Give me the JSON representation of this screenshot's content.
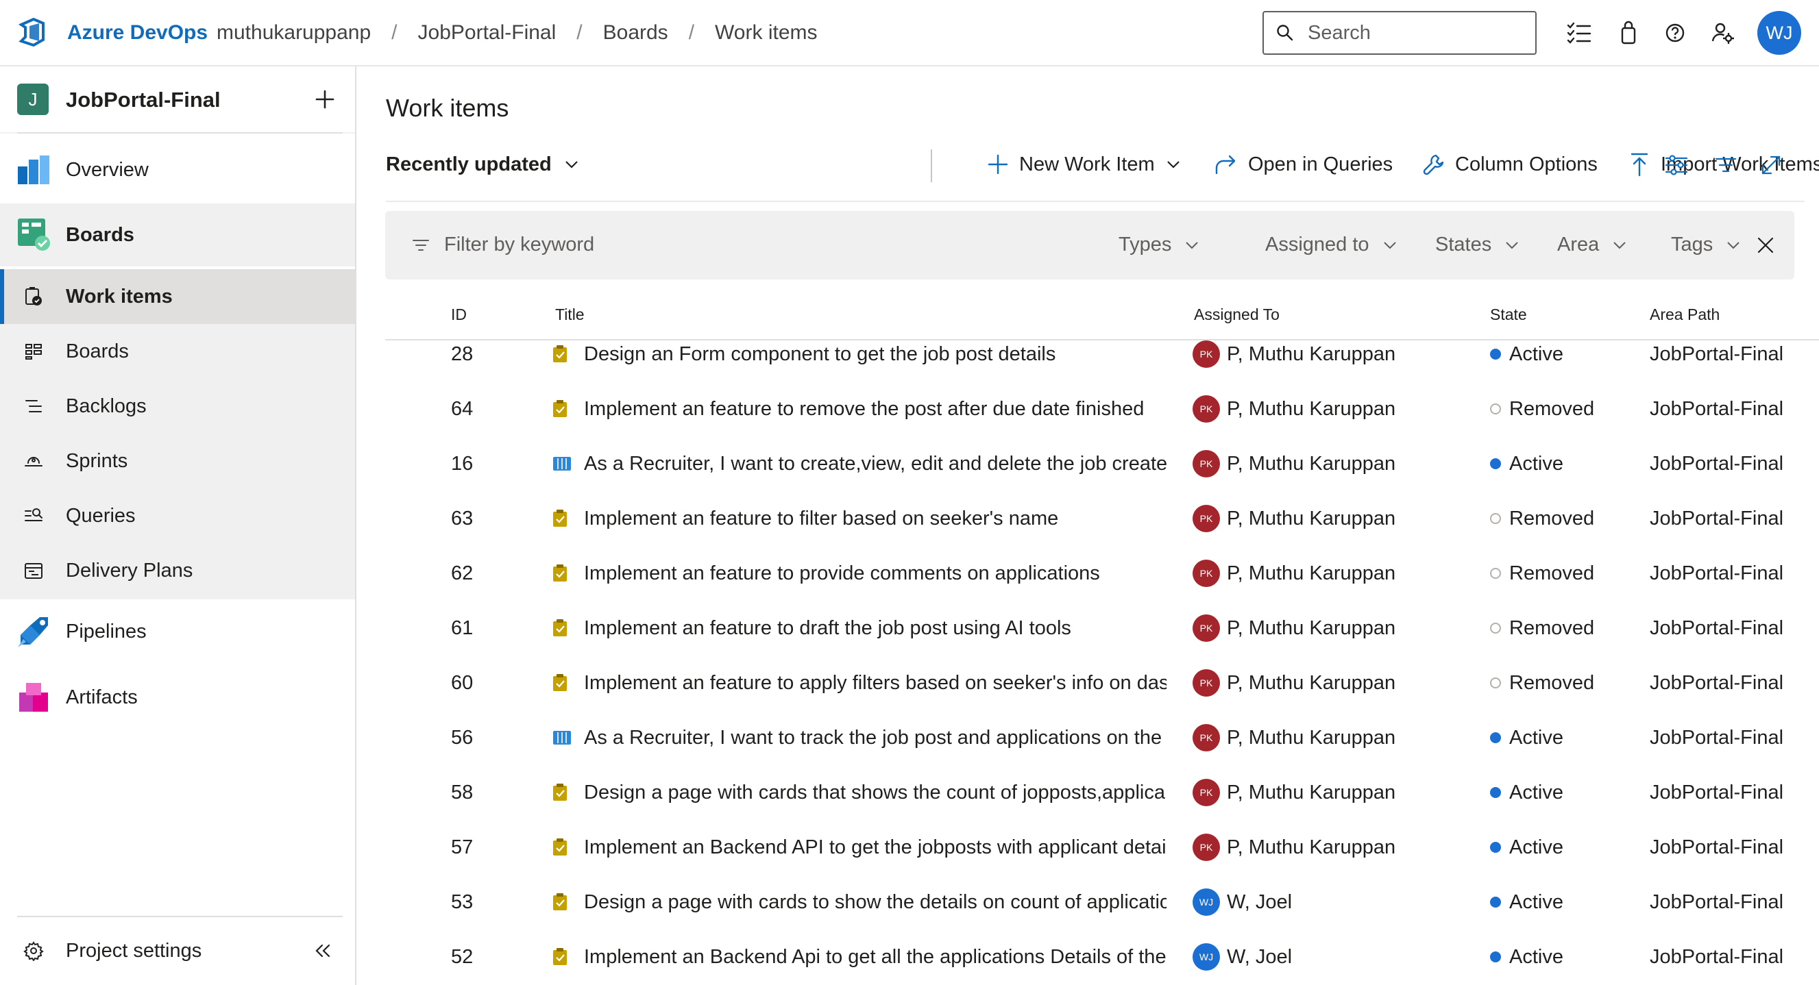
{
  "header": {
    "brand": "Azure DevOps",
    "breadcrumbs": [
      "muthukaruppanp",
      "JobPortal-Final",
      "Boards",
      "Work items"
    ],
    "separator": "/",
    "search_placeholder": "Search",
    "user_initials": "WJ",
    "icons": [
      "checklist-icon",
      "shopping-bag-icon",
      "help-icon",
      "user-settings-icon"
    ]
  },
  "sidebar": {
    "project_initial": "J",
    "project_name": "JobPortal-Final",
    "items": [
      {
        "label": "Overview",
        "icon": "overview-icon"
      },
      {
        "label": "Boards",
        "icon": "boards-hub-icon"
      },
      {
        "label": "Work items",
        "icon": "work-items-icon",
        "selected": true
      },
      {
        "label": "Boards",
        "icon": "boards-icon"
      },
      {
        "label": "Backlogs",
        "icon": "backlogs-icon"
      },
      {
        "label": "Sprints",
        "icon": "sprints-icon"
      },
      {
        "label": "Queries",
        "icon": "queries-icon"
      },
      {
        "label": "Delivery Plans",
        "icon": "delivery-plans-icon"
      },
      {
        "label": "Pipelines",
        "icon": "pipelines-icon"
      },
      {
        "label": "Artifacts",
        "icon": "artifacts-icon"
      }
    ],
    "settings_label": "Project settings"
  },
  "main": {
    "title": "Work items",
    "toolbar": {
      "view_selector": "Recently updated",
      "new_work_item": "New Work Item",
      "open_in_queries": "Open in Queries",
      "column_options": "Column Options",
      "import_work_items": "Import Work Items",
      "more": "···"
    },
    "filter": {
      "placeholder": "Filter by keyword",
      "chips": [
        "Types",
        "Assigned to",
        "States",
        "Area",
        "Tags"
      ]
    },
    "columns": [
      "ID",
      "Title",
      "Assigned To",
      "State",
      "Area Path"
    ],
    "rows": [
      {
        "id": "28",
        "type": "task",
        "title": "Design an Form component to get the job post details",
        "assignee_initials": "PK",
        "assignee": "P, Muthu Karuppan",
        "state": "Active",
        "area": "JobPortal-Final"
      },
      {
        "id": "64",
        "type": "task",
        "title": "Implement an feature to remove the post after due date finished",
        "assignee_initials": "PK",
        "assignee": "P, Muthu Karuppan",
        "state": "Removed",
        "area": "JobPortal-Final"
      },
      {
        "id": "16",
        "type": "story",
        "title": "As a Recruiter, I want to create,view, edit and delete the job created",
        "assignee_initials": "PK",
        "assignee": "P, Muthu Karuppan",
        "state": "Active",
        "area": "JobPortal-Final"
      },
      {
        "id": "63",
        "type": "task",
        "title": "Implement an feature to filter based on seeker's name",
        "assignee_initials": "PK",
        "assignee": "P, Muthu Karuppan",
        "state": "Removed",
        "area": "JobPortal-Final"
      },
      {
        "id": "62",
        "type": "task",
        "title": "Implement an feature to provide comments on applications",
        "assignee_initials": "PK",
        "assignee": "P, Muthu Karuppan",
        "state": "Removed",
        "area": "JobPortal-Final"
      },
      {
        "id": "61",
        "type": "task",
        "title": "Implement an feature to draft the job post using AI tools",
        "assignee_initials": "PK",
        "assignee": "P, Muthu Karuppan",
        "state": "Removed",
        "area": "JobPortal-Final"
      },
      {
        "id": "60",
        "type": "task",
        "title": "Implement an feature to apply filters based on seeker's info on das",
        "assignee_initials": "PK",
        "assignee": "P, Muthu Karuppan",
        "state": "Removed",
        "area": "JobPortal-Final"
      },
      {
        "id": "56",
        "type": "story",
        "title": "As a Recruiter, I want to track the job post and applications on the",
        "assignee_initials": "PK",
        "assignee": "P, Muthu Karuppan",
        "state": "Active",
        "area": "JobPortal-Final"
      },
      {
        "id": "58",
        "type": "task",
        "title": "Design a page with cards that shows the count of jopposts,applica",
        "assignee_initials": "PK",
        "assignee": "P, Muthu Karuppan",
        "state": "Active",
        "area": "JobPortal-Final"
      },
      {
        "id": "57",
        "type": "task",
        "title": "Implement an Backend API to get the jobposts with applicant detai",
        "assignee_initials": "PK",
        "assignee": "P, Muthu Karuppan",
        "state": "Active",
        "area": "JobPortal-Final"
      },
      {
        "id": "53",
        "type": "task",
        "title": "Design a page with cards to show the details on count of applicatic",
        "assignee_initials": "WJ",
        "assignee": "W, Joel",
        "state": "Active",
        "area": "JobPortal-Final"
      },
      {
        "id": "52",
        "type": "task",
        "title": "Implement an Backend Api to get all the applications Details of the",
        "assignee_initials": "WJ",
        "assignee": "W, Joel",
        "state": "Active",
        "area": "JobPortal-Final"
      }
    ]
  },
  "colors": {
    "brand_blue": "#0f6cbd",
    "active_dot": "#1b6fd3",
    "pk_avatar": "#a4262c",
    "wj_avatar": "#1b6fd3",
    "task_icon": "#c4a000",
    "story_icon": "#2b88d8"
  }
}
